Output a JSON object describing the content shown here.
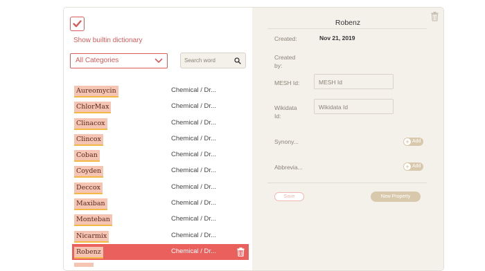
{
  "left_panel": {
    "builtin_checkbox_checked": true,
    "builtin_label": "Show builtin dictionary",
    "category_select_value": "All Categories",
    "search_placeholder": "Search word",
    "words": [
      {
        "word": "Aureomycin",
        "category": "Chemical / Dr..."
      },
      {
        "word": "ChlorMax",
        "category": "Chemical / Dr..."
      },
      {
        "word": "Clinacox",
        "category": "Chemical / Dr..."
      },
      {
        "word": "Clincox",
        "category": "Chemical / Dr..."
      },
      {
        "word": "Coban",
        "category": "Chemical / Dr..."
      },
      {
        "word": "Coyden",
        "category": "Chemical / Dr..."
      },
      {
        "word": "Deccox",
        "category": "Chemical / Dr..."
      },
      {
        "word": "Maxiban",
        "category": "Chemical / Dr..."
      },
      {
        "word": "Monteban",
        "category": "Chemical / Dr..."
      },
      {
        "word": "Nicarmix",
        "category": "Chemical / Dr..."
      },
      {
        "word": "Robenz",
        "category": "Chemical / Dr...",
        "selected": true
      }
    ]
  },
  "detail": {
    "title": "Robenz",
    "created_label": "Created:",
    "created_value": "Nov 21, 2019",
    "created_by_label_1": "Created",
    "created_by_label_2": "by:",
    "mesh_label": "MESH Id:",
    "mesh_placeholder": "MESH Id",
    "wikidata_label_1": "Wikidata",
    "wikidata_label_2": "Id:",
    "wikidata_placeholder": "Wikidata Id",
    "synonyms_label": "Synony...",
    "abbreviations_label": "Abbrevia...",
    "add_label": "Add",
    "save_label": "Save",
    "new_property_label": "New Property"
  },
  "colors": {
    "accent": "#e9605d",
    "highlight": "#f6c4b2",
    "underline": "#f4b942",
    "panel_bg": "#f4f1ea",
    "tan_button": "#d8c9ad"
  },
  "icons": {
    "check": "check-icon",
    "chevron": "chevron-down-icon",
    "search": "search-icon",
    "trash": "trash-icon",
    "plus": "plus-icon"
  }
}
